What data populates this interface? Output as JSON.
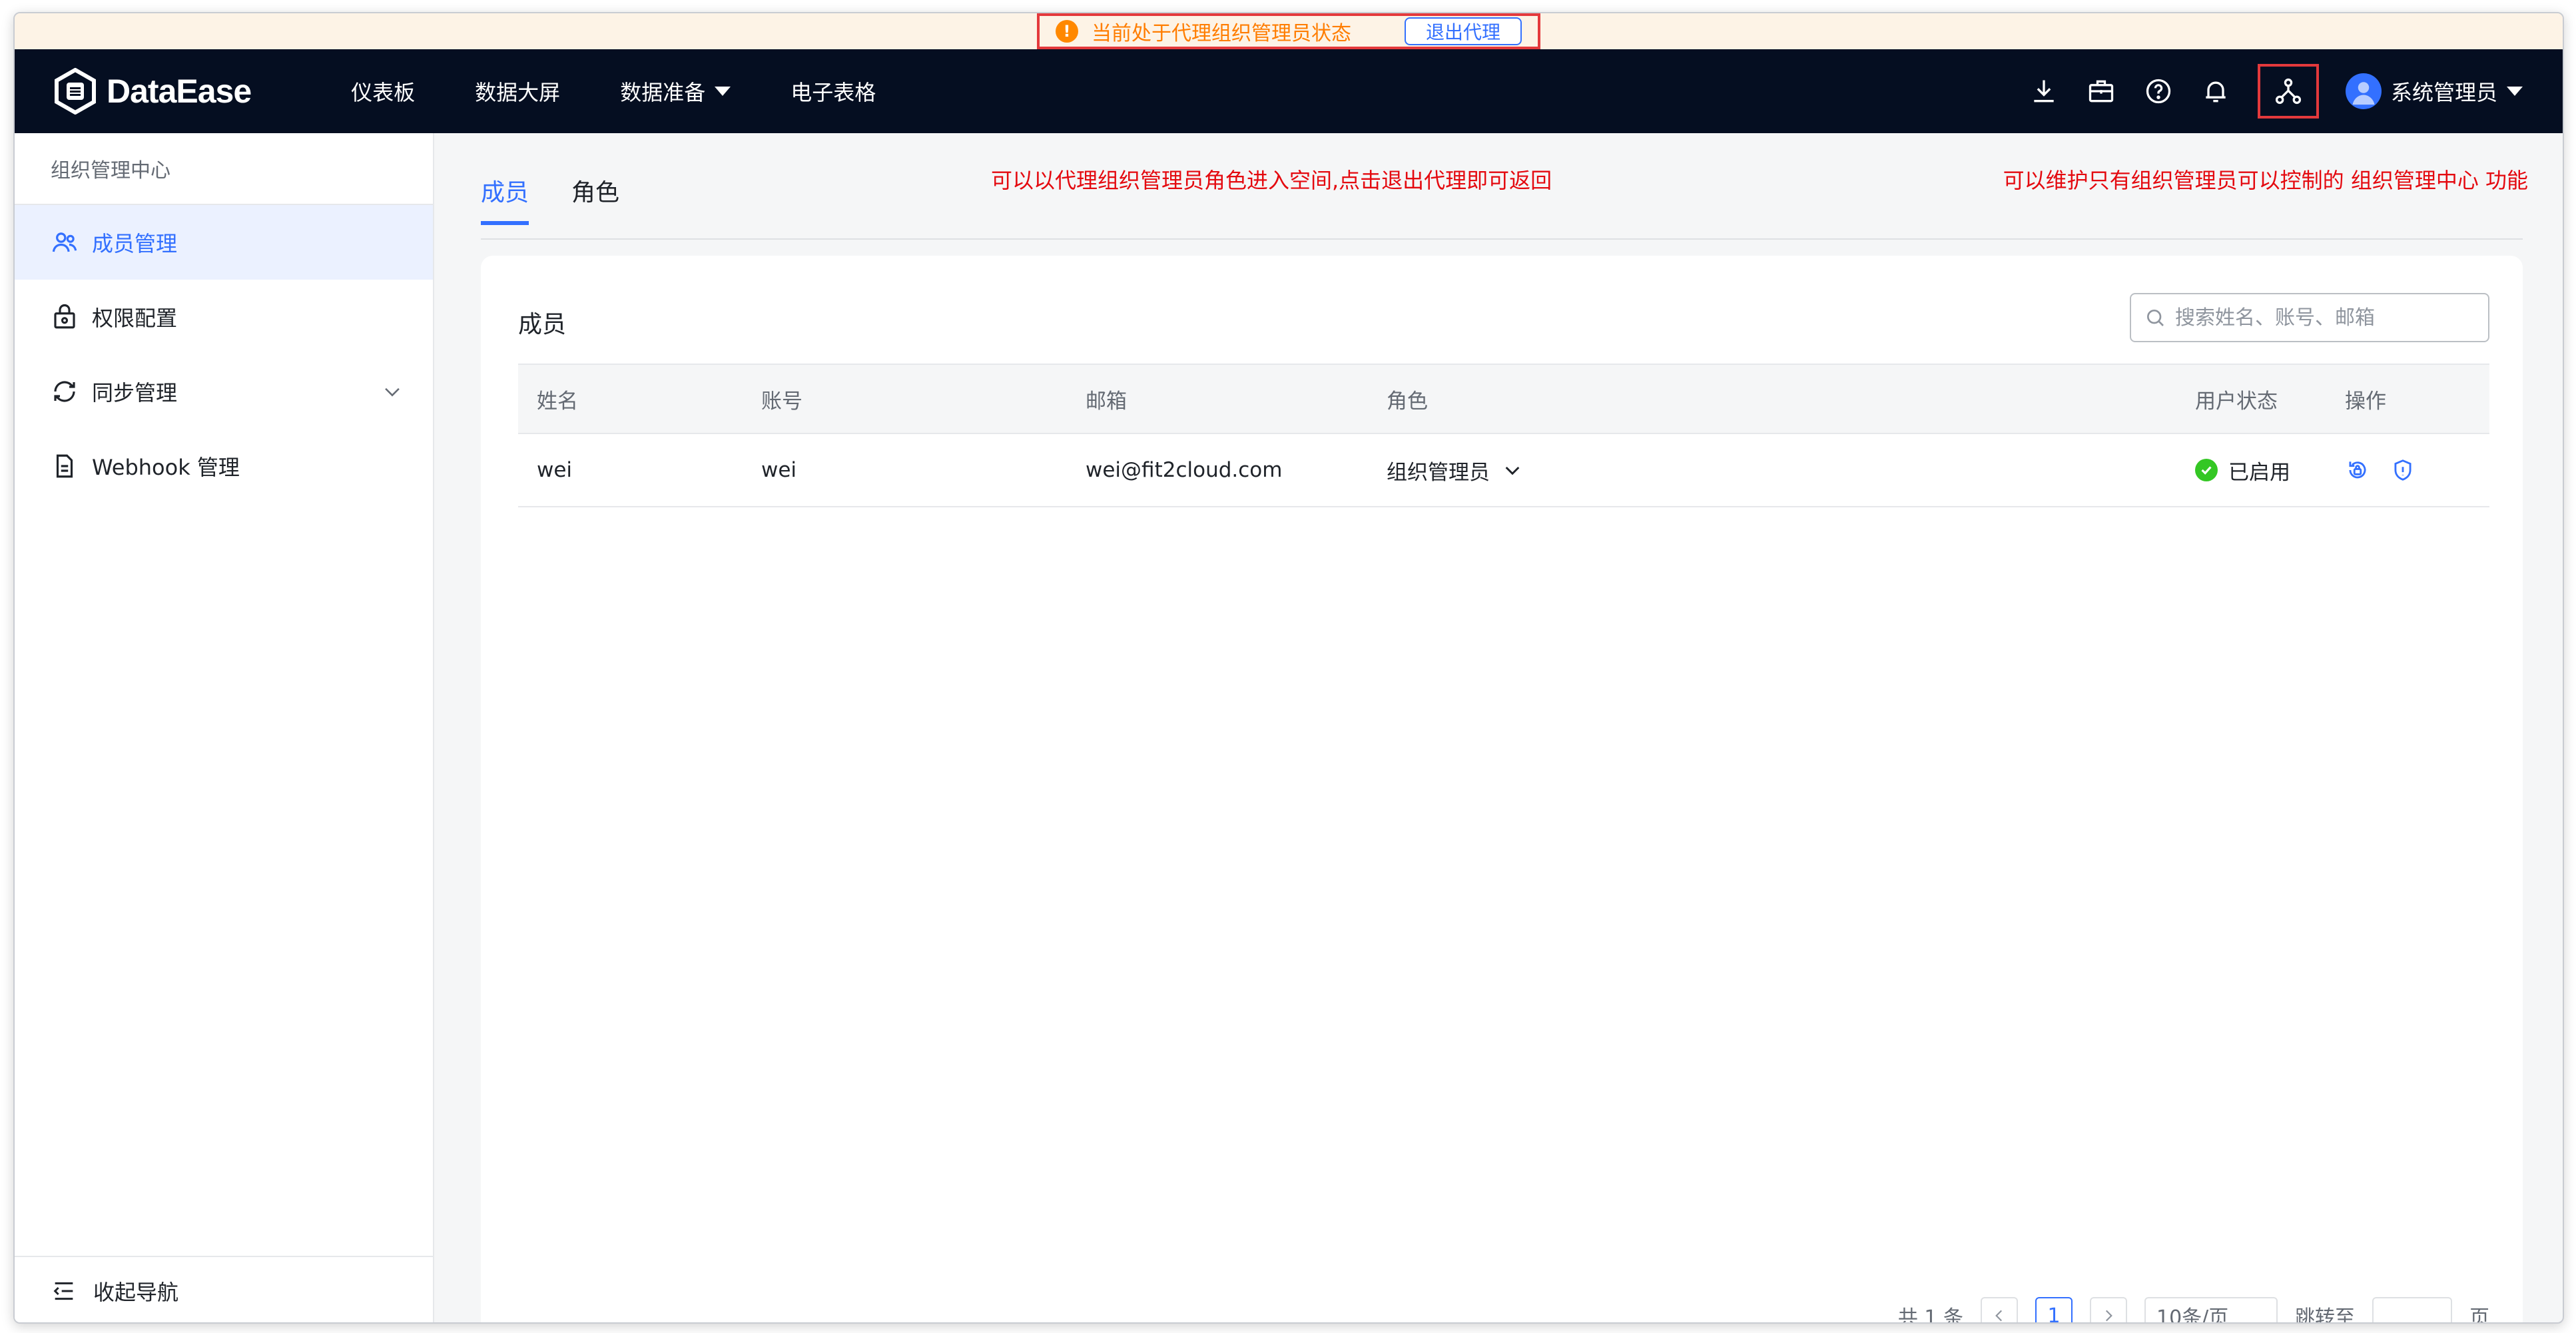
{
  "banner": {
    "message": "当前处于代理组织管理员状态",
    "exit_label": "退出代理",
    "warn_glyph": "!"
  },
  "app": {
    "logo_text": "DataEase"
  },
  "nav": {
    "items": [
      {
        "label": "仪表板"
      },
      {
        "label": "数据大屏"
      },
      {
        "label": "数据准备"
      },
      {
        "label": "电子表格"
      }
    ],
    "user_name": "系统管理员"
  },
  "sidebar": {
    "header": "组织管理中心",
    "items": [
      {
        "label": "成员管理"
      },
      {
        "label": "权限配置"
      },
      {
        "label": "同步管理"
      },
      {
        "label": "Webhook 管理"
      }
    ],
    "collapse_label": "收起导航"
  },
  "annotations": {
    "center": "可以以代理组织管理员角色进入空间,点击退出代理即可返回",
    "right": "可以维护只有组织管理员可以控制的 组织管理中心 功能"
  },
  "tabs": [
    {
      "label": "成员"
    },
    {
      "label": "角色"
    }
  ],
  "card": {
    "title": "成员",
    "search_placeholder": "搜索姓名、账号、邮箱"
  },
  "table": {
    "headers": [
      "姓名",
      "账号",
      "邮箱",
      "角色",
      "用户状态",
      "操作"
    ],
    "rows": [
      {
        "name": "wei",
        "account": "wei",
        "email": "wei@fit2cloud.com",
        "role": "组织管理员",
        "status": "已启用"
      }
    ]
  },
  "pager": {
    "total": "共 1 条",
    "current": "1",
    "page_size": "10条/页",
    "jump_label": "跳转至",
    "page_unit": "页"
  },
  "colors": {
    "accent": "#3370ff",
    "nav_bg": "#050e21",
    "highlight_red": "#e4393c",
    "status_green": "#34c724",
    "warn_orange": "#ff8800"
  }
}
